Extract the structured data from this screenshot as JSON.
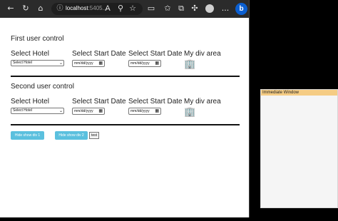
{
  "browser": {
    "address": {
      "host": "localhost",
      "rest": ":5405..."
    },
    "icons": [
      "back-icon",
      "refresh-icon",
      "home-icon",
      "info-icon",
      "read-aloud-icon",
      "zoom-icon",
      "favorite-icon",
      "split-screen-icon",
      "favorites-list-icon",
      "collections-icon",
      "extensions-icon",
      "profile-icon",
      "more-icon",
      "bing-icon"
    ],
    "read_aloud_text": "A",
    "more_text": "...",
    "bing_text": "b"
  },
  "page": {
    "controls": [
      {
        "title": "First user control",
        "labels": {
          "hotel": "Select Hotel",
          "start1": "Select Start Date",
          "start2": "Select Start Date",
          "div": "My div area"
        },
        "select_value": "Select Hotel",
        "date1": "mm/dd/yyyy",
        "date2": "mm/dd/yyyy"
      },
      {
        "title": "Second user control",
        "labels": {
          "hotel": "Select Hotel",
          "start1": "Select Start Date",
          "start2": "Select Start Date",
          "div": "My div area"
        },
        "select_value": "Select Hotel",
        "date1": "mm/dd/yyyy",
        "date2": "mm/dd/yyyy"
      }
    ],
    "buttons": {
      "hide_div1": "Hide show div 1",
      "hide_div2": "Hide show div 2",
      "test": "test"
    }
  },
  "immediate": {
    "title": "Immediate Window"
  },
  "colors": {
    "accent": "#5bc0de",
    "panel_title": "#f5cc84",
    "toolbar": "#2b2b2b"
  }
}
